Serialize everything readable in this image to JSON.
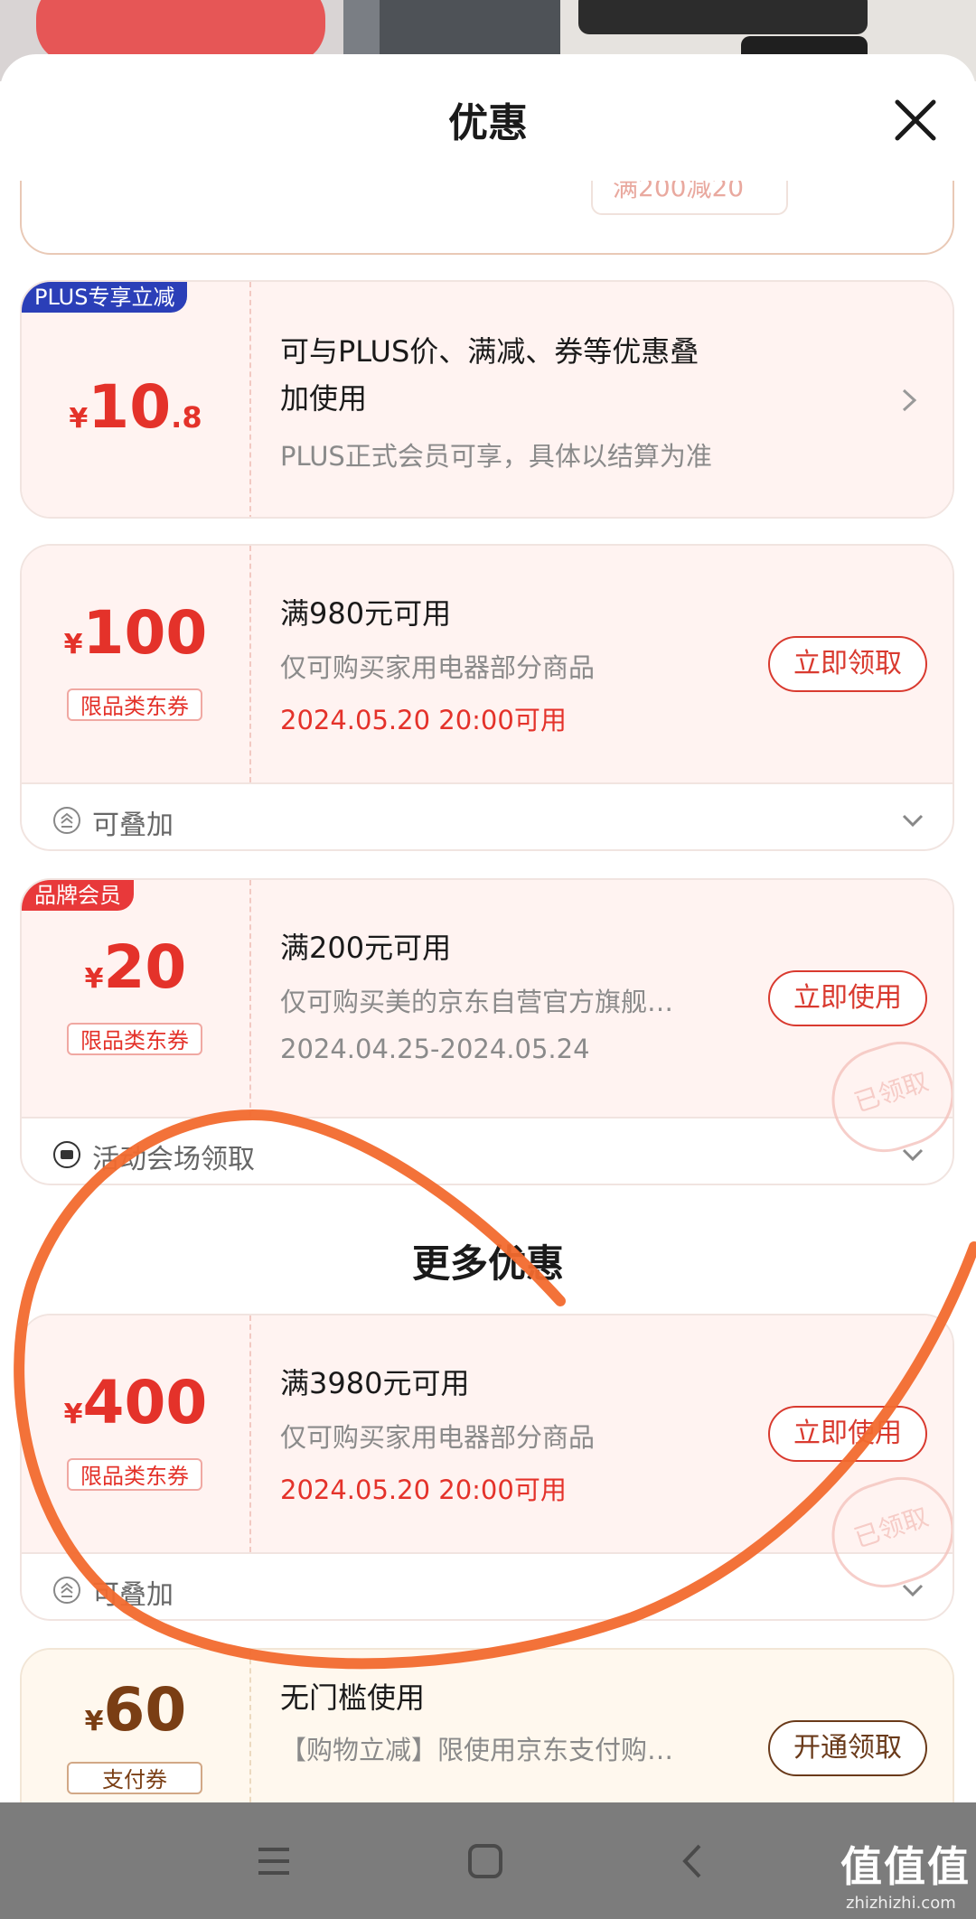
{
  "sheet": {
    "title": "优惠",
    "partial_coupon": "满200减20"
  },
  "plus_card": {
    "tag": "PLUS专享立减",
    "yen": "¥",
    "amount_int": "10",
    "amount_dec": ".8",
    "line1": "可与PLUS价、满减、券等优惠叠",
    "line2": "加使用",
    "note": "PLUS正式会员可享，具体以结算为准"
  },
  "coupon1": {
    "yen": "¥",
    "amount": "100",
    "kind": "限品类东券",
    "title": "满980元可用",
    "desc": "仅可购买家用电器部分商品",
    "date": "2024.05.20 20:00可用",
    "button": "立即领取",
    "footer": "可叠加"
  },
  "coupon2": {
    "tag": "品牌会员",
    "yen": "¥",
    "amount": "20",
    "kind": "限品类东券",
    "title": "满200元可用",
    "desc": "仅可购买美的京东自营官方旗舰…",
    "date": "2024.04.25-2024.05.24",
    "button": "立即使用",
    "stamp": "已领取",
    "footer": "活动会场领取"
  },
  "more_section": {
    "title": "更多优惠"
  },
  "coupon3": {
    "yen": "¥",
    "amount": "400",
    "kind": "限品类东券",
    "title": "满3980元可用",
    "desc": "仅可购买家用电器部分商品",
    "date": "2024.05.20 20:00可用",
    "button": "立即使用",
    "stamp": "已领取",
    "footer": "可叠加"
  },
  "coupon4": {
    "yen": "¥",
    "amount": "60",
    "kind": "支付券",
    "title": "无门槛使用",
    "desc": "【购物立减】限使用京东支付购…",
    "button": "开通领取"
  },
  "watermark": {
    "big": "值值值",
    "small": "zhizhizhi.com"
  },
  "colors": {
    "accent_red": "#e4322a",
    "plus_blue": "#2b3fb8",
    "brand_red": "#e8393a",
    "annotation_orange": "#f26a2e"
  }
}
